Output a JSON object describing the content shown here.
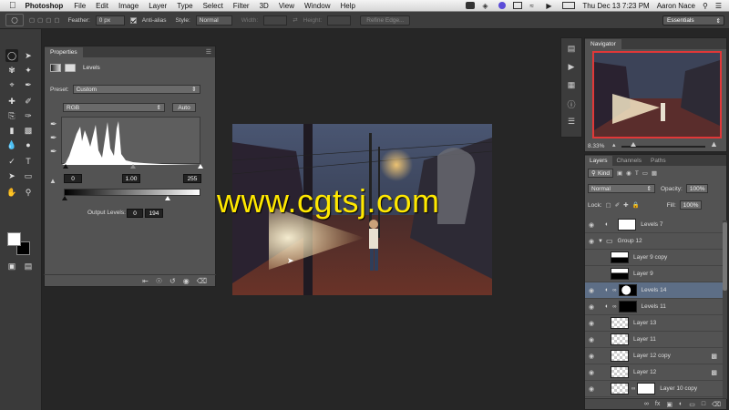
{
  "menubar": {
    "app_name": "Photoshop",
    "items": [
      "File",
      "Edit",
      "Image",
      "Layer",
      "Type",
      "Select",
      "Filter",
      "3D",
      "View",
      "Window",
      "Help"
    ],
    "clock": "Thu Dec 13  7:23 PM",
    "user": "Aaron Nace"
  },
  "options": {
    "feather_label": "Feather:",
    "feather_value": "0 px",
    "antialias_label": "Anti-alias",
    "style_label": "Style:",
    "style_value": "Normal",
    "width_label": "Width:",
    "height_label": "Height:",
    "refine_label": "Refine Edge...",
    "workspace": "Essentials"
  },
  "properties": {
    "tab": "Properties",
    "title": "Levels",
    "preset_label": "Preset:",
    "preset_value": "Custom",
    "channel": "RGB",
    "auto_label": "Auto",
    "input_black": "0",
    "input_gamma": "1.00",
    "input_white": "255",
    "output_label": "Output Levels:",
    "output_black": "0",
    "output_white": "194"
  },
  "navigator": {
    "tab": "Navigator",
    "zoom": "8.33%"
  },
  "layers_panel": {
    "tabs": [
      "Layers",
      "Channels",
      "Paths"
    ],
    "kind_label": "Kind",
    "blend_mode": "Normal",
    "opacity_label": "Opacity:",
    "opacity_value": "100%",
    "lock_label": "Lock:",
    "fill_label": "Fill:",
    "fill_value": "100%",
    "layers": [
      {
        "name": "Levels 7"
      },
      {
        "name": "Group 12"
      },
      {
        "name": "Layer 9 copy"
      },
      {
        "name": "Layer 9"
      },
      {
        "name": "Levels 14"
      },
      {
        "name": "Levels 11"
      },
      {
        "name": "Layer 13"
      },
      {
        "name": "Layer 11"
      },
      {
        "name": "Layer 12 copy"
      },
      {
        "name": "Layer 12"
      },
      {
        "name": "Layer 10 copy"
      }
    ]
  },
  "watermark": "www.cgtsj.com"
}
